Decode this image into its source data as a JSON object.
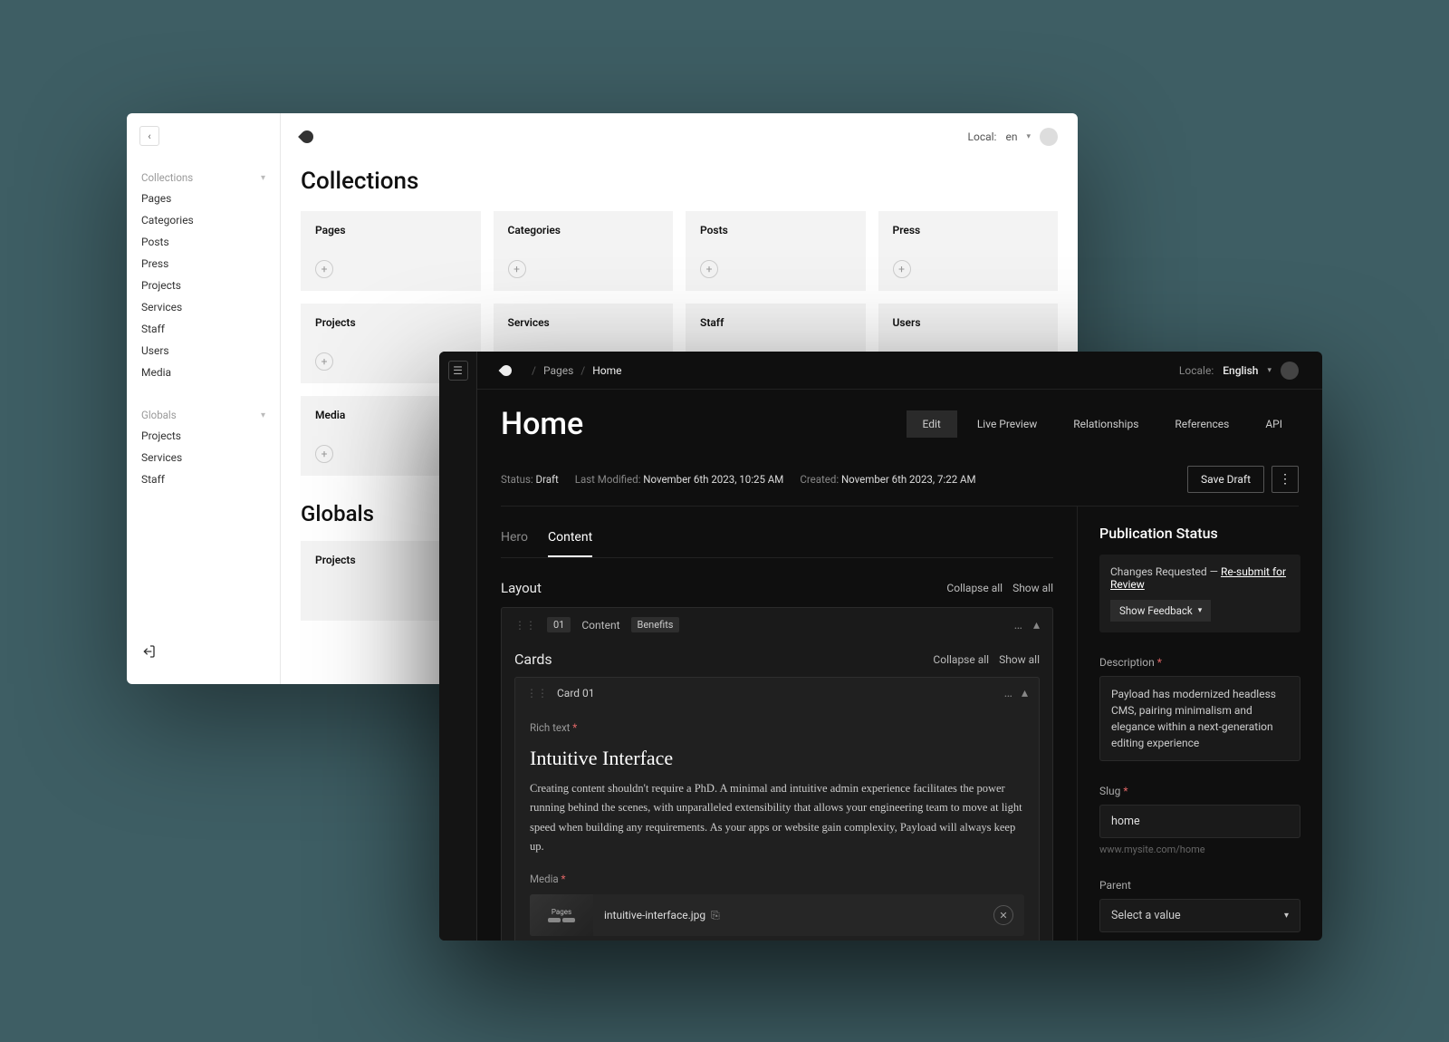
{
  "light": {
    "topbar": {
      "local_label": "Local:",
      "locale_value": "en"
    },
    "sidebar": {
      "groups": [
        {
          "label": "Collections",
          "items": [
            "Pages",
            "Categories",
            "Posts",
            "Press",
            "Projects",
            "Services",
            "Staff",
            "Users",
            "Media"
          ]
        },
        {
          "label": "Globals",
          "items": [
            "Projects",
            "Services",
            "Staff"
          ]
        }
      ]
    },
    "sections": [
      {
        "title": "Collections",
        "cards": [
          "Pages",
          "Categories",
          "Posts",
          "Press",
          "Projects",
          "Services",
          "Staff",
          "Users",
          "Media"
        ]
      },
      {
        "title": "Globals",
        "cards": [
          "Projects"
        ]
      }
    ]
  },
  "dark": {
    "breadcrumb": {
      "items": [
        "Pages",
        "Home"
      ]
    },
    "locale": {
      "label": "Locale:",
      "value": "English"
    },
    "page_title": "Home",
    "tabs": [
      "Edit",
      "Live Preview",
      "Relationships",
      "References",
      "API"
    ],
    "active_tab": "Edit",
    "meta": {
      "status_label": "Status:",
      "status_value": "Draft",
      "modified_label": "Last Modified:",
      "modified_value": "November 6th 2023, 10:25 AM",
      "created_label": "Created:",
      "created_value": "November 6th 2023, 7:22 AM",
      "save_label": "Save Draft"
    },
    "subtabs": [
      "Hero",
      "Content"
    ],
    "active_subtab": "Content",
    "layout": {
      "title": "Layout",
      "collapse_label": "Collapse all",
      "show_label": "Show all",
      "block": {
        "index": "01",
        "type_label": "Content",
        "name": "Benefits",
        "cards": {
          "title": "Cards",
          "collapse_label": "Collapse all",
          "show_label": "Show all",
          "card": {
            "title": "Card 01",
            "richtext_label": "Rich text",
            "heading": "Intuitive Interface",
            "body": "Creating content shouldn't require a PhD. A minimal and intuitive admin experience facilitates the power running behind the scenes, with unparalleled extensibility that allows your engineering team to move at light speed when building any requirements. As your apps or website gain complexity, Payload will always keep up.",
            "media_label": "Media",
            "thumb_label": "Pages",
            "media_filename": "intuitive-interface.jpg"
          }
        }
      }
    },
    "sidebar": {
      "pub_title": "Publication Status",
      "pub_changes": "Changes Requested —",
      "pub_link": "Re-submit for Review",
      "feedback_btn": "Show Feedback",
      "description_label": "Description",
      "description_value": "Payload has modernized headless CMS, pairing minimalism and elegance within a next-generation editing experience",
      "slug_label": "Slug",
      "slug_value": "home",
      "slug_hint": "www.mysite.com/home",
      "parent_label": "Parent",
      "parent_placeholder": "Select a value"
    }
  }
}
